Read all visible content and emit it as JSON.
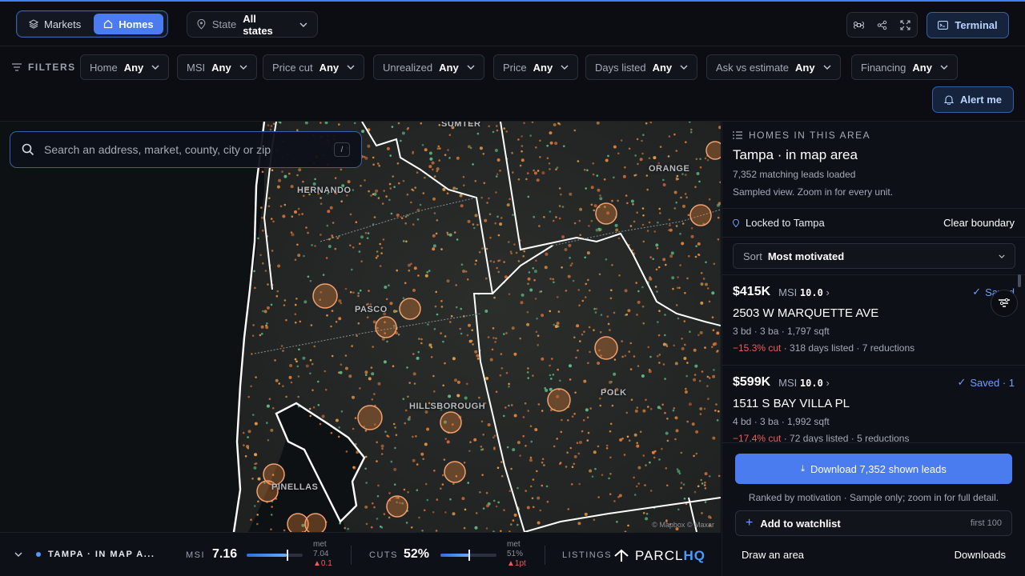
{
  "topbar": {
    "segments": [
      {
        "label": "Markets",
        "icon": "layers-icon"
      },
      {
        "label": "Homes",
        "icon": "home-icon"
      }
    ],
    "state_label": "State",
    "state_value": "All states",
    "terminal_label": "Terminal"
  },
  "filters": {
    "label": "FILTERS",
    "chips": [
      {
        "key": "Home",
        "value": "Any"
      },
      {
        "key": "MSI",
        "value": "Any"
      },
      {
        "key": "Price cut",
        "value": "Any"
      },
      {
        "key": "Unrealized",
        "value": "Any"
      },
      {
        "key": "Price",
        "value": "Any"
      },
      {
        "key": "Days listed",
        "value": "Any"
      },
      {
        "key": "Ask vs estimate",
        "value": "Any"
      },
      {
        "key": "Financing",
        "value": "Any"
      }
    ],
    "alert_label": "Alert me"
  },
  "search": {
    "placeholder": "Search an address, market, county, city or zip",
    "shortcut": "/"
  },
  "map": {
    "labels": [
      "SUMTER",
      "HERNANDO",
      "ORANGE",
      "PASCO",
      "HILLSBOROUGH",
      "POLK",
      "PINELLAS"
    ],
    "attribution": "© Mapbox © Maxar"
  },
  "bottom": {
    "area": "TAMPA · IN MAP A...",
    "msi_label": "MSI",
    "msi_value": "7.16",
    "msi_fill": 0.72,
    "msi_met_label": "met",
    "msi_met_value": "7.04",
    "msi_delta": "▲0.1",
    "cuts_label": "CUTS",
    "cuts_value": "52%",
    "cuts_fill": 0.52,
    "cuts_met_label": "met",
    "cuts_met_value": "51%",
    "cuts_delta": "▲1pt",
    "listings_label": "LISTINGS",
    "brand_a": "PARCL",
    "brand_b": "HQ"
  },
  "panel": {
    "eyebrow": "HOMES IN THIS AREA",
    "title": "Tampa · in map area",
    "matching": "7,352 matching leads loaded",
    "sampled": "Sampled view. Zoom in for every unit.",
    "locked": "Locked to Tampa",
    "clear": "Clear boundary",
    "sort_label": "Sort",
    "sort_value": "Most motivated",
    "listings": [
      {
        "price": "$415K",
        "msi_label": "MSI",
        "msi": "10.0",
        "saved": "Saved",
        "address": "2503 W MARQUETTE AVE",
        "specs": "3 bd · 3 ba · 1,797 sqft",
        "cut": "−15.3% cut",
        "rest": " · 318 days listed · 7 reductions"
      },
      {
        "price": "$599K",
        "msi_label": "MSI",
        "msi": "10.0",
        "saved": "Saved · 1",
        "address": "1511 S BAY VILLA PL",
        "specs": "4 bd · 3 ba · 1,992 sqft",
        "cut": "−17.4% cut",
        "rest": " · 72 days listed · 5 reductions"
      }
    ],
    "download": "Download 7,352 shown leads",
    "rank_note": "Ranked by motivation · Sample only; zoom in for full detail.",
    "watchlist": "Add to watchlist",
    "watchlist_note": "first 100",
    "draw": "Draw an area",
    "downloads": "Downloads"
  },
  "colors": {
    "accent": "#4a7cf0",
    "cut_red": "#ef5b5b",
    "dot_orange": "#e8833a",
    "dot_green": "#5fbf8a"
  }
}
